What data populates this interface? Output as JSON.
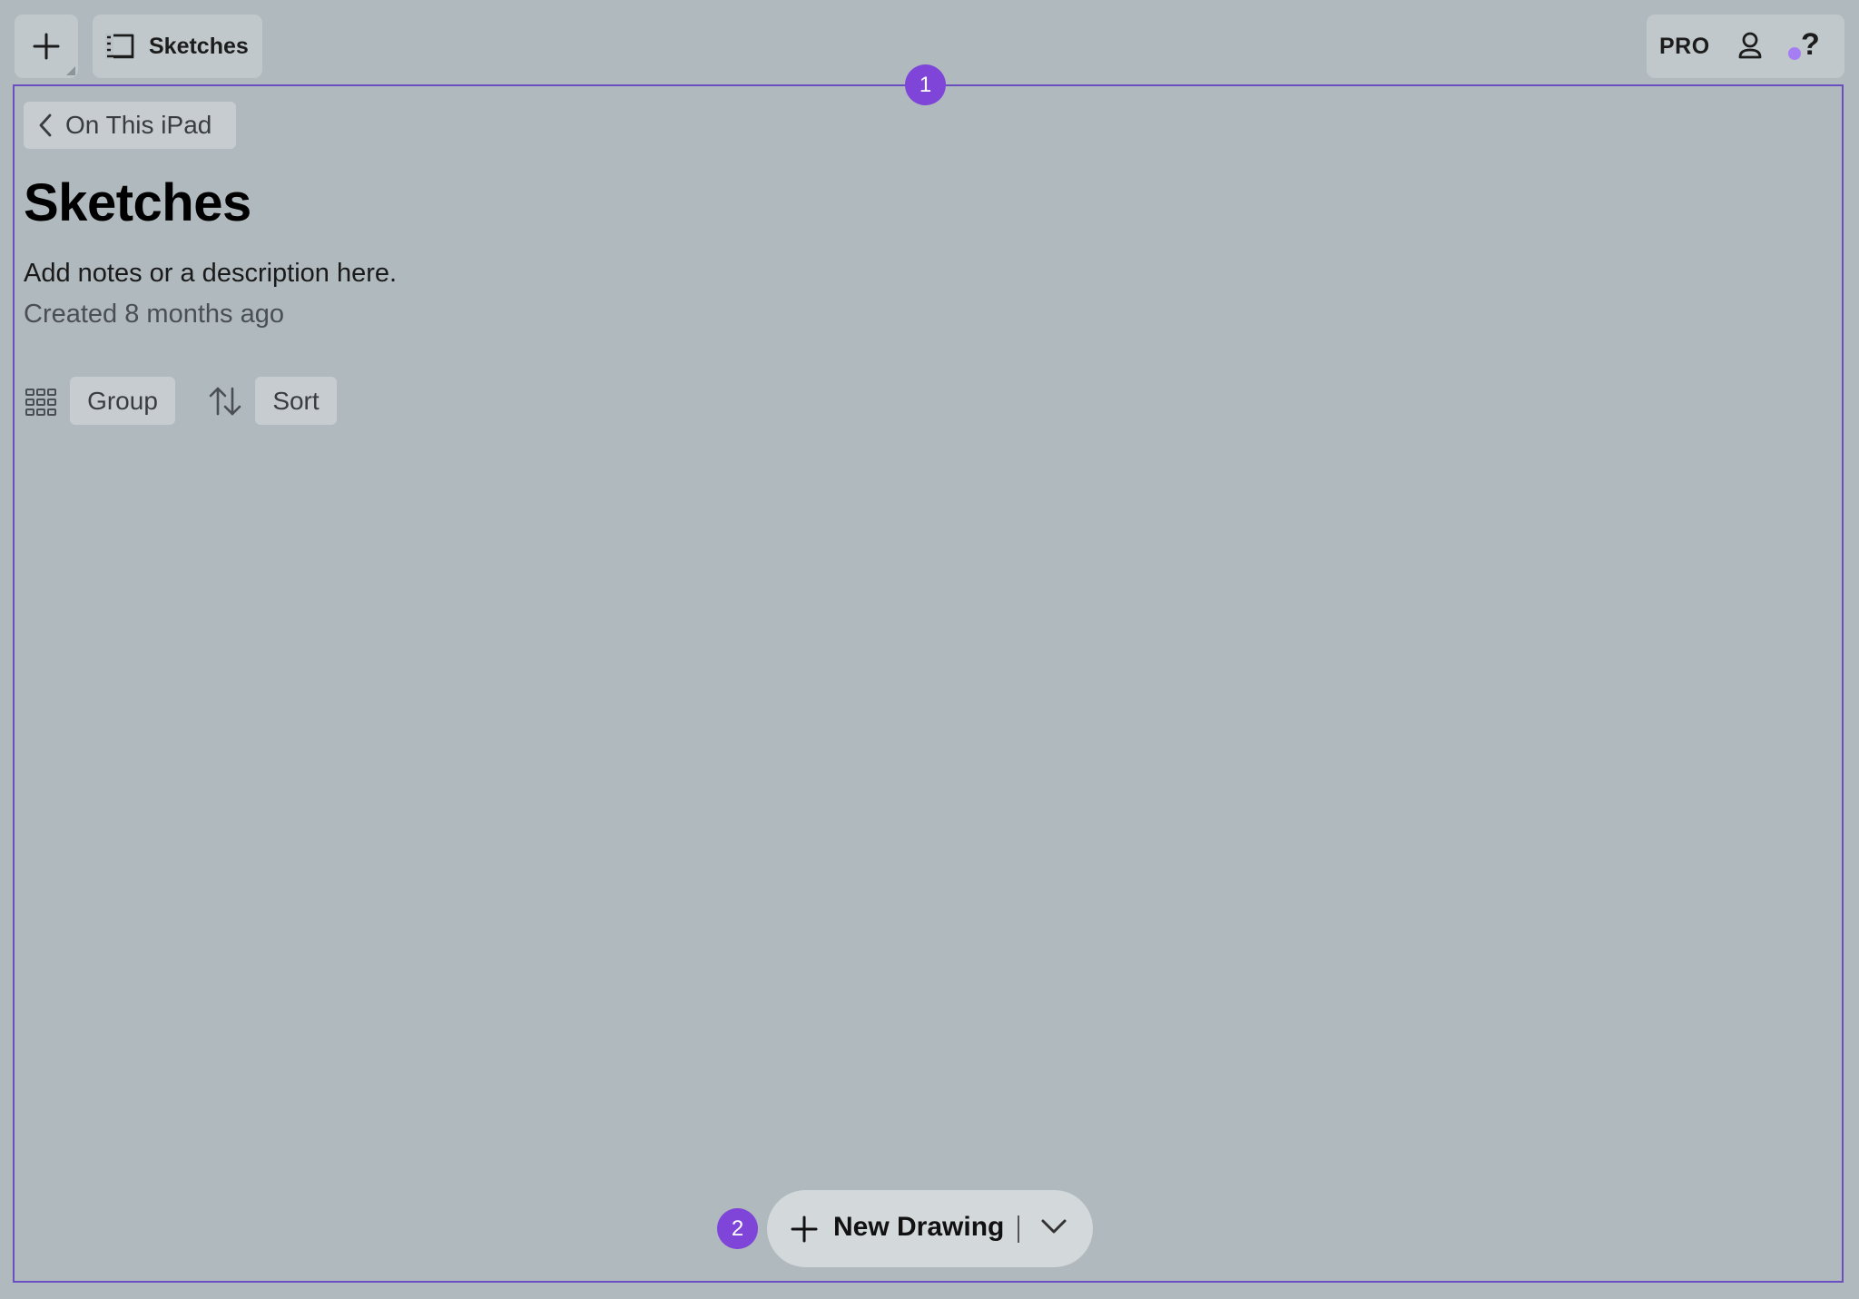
{
  "topbar": {
    "add_icon": "plus-icon",
    "sketches_icon": "sidebar-list-icon",
    "sketches_label": "Sketches",
    "pro_label": "PRO",
    "user_icon": "person-icon",
    "help_label": "?",
    "help_dot_color": "#a57ef3"
  },
  "markers": {
    "one": "1",
    "two": "2",
    "color": "#7f45d9"
  },
  "main": {
    "back_label": "On This iPad",
    "title": "Sketches",
    "description": "Add notes or a description here.",
    "created": "Created 8 months ago",
    "group_label": "Group",
    "sort_label": "Sort"
  },
  "footer": {
    "new_drawing_label": "New Drawing"
  },
  "colors": {
    "background": "#b0b9bd",
    "frame_border": "#6a4fc0"
  }
}
